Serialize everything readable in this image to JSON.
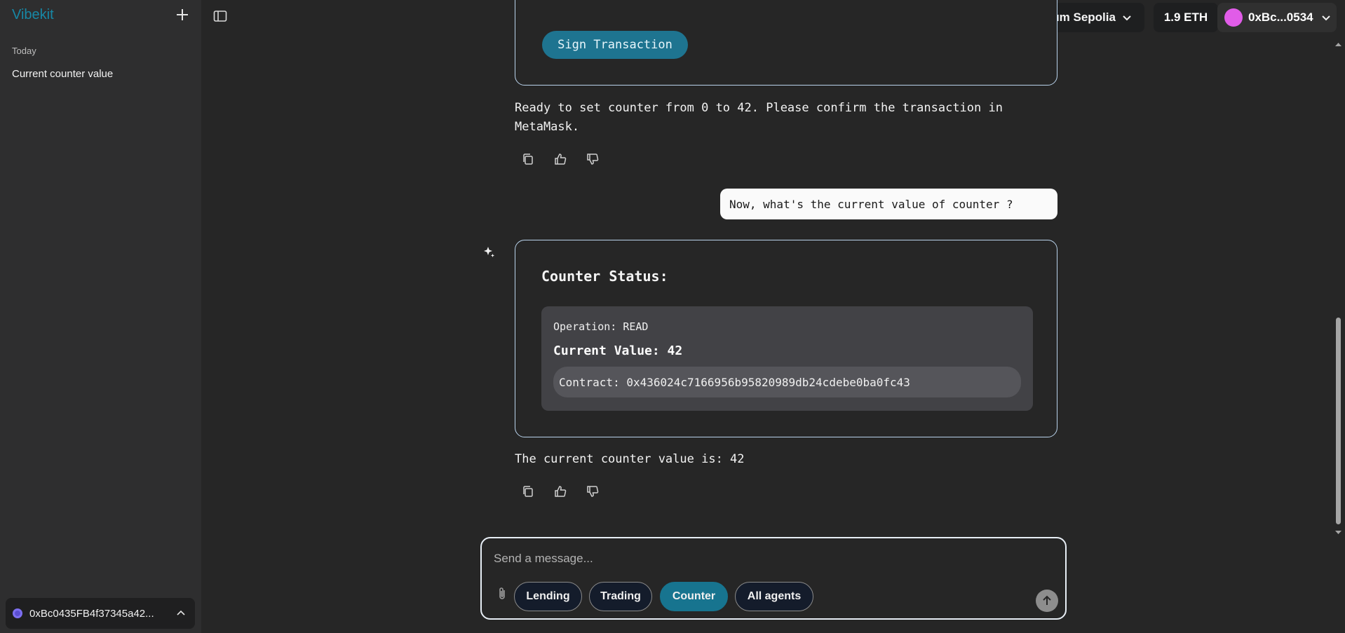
{
  "sidebar": {
    "brand": "Vibekit",
    "section_label": "Today",
    "history": [
      "Current counter value"
    ],
    "wallet_address": "0xBc0435FB4f37345a42..."
  },
  "topbar": {
    "network": "Arbitrum Sepolia",
    "balance": "1.9 ETH",
    "account": "0xBc...0534"
  },
  "chat": {
    "sign_button": "Sign Transaction",
    "ready_text_line1": "Ready to set counter from 0 to 42. Please confirm the transaction in",
    "ready_text_line2": "MetaMask.",
    "user_message": "Now, what's the current value of counter ?",
    "status_card": {
      "title": "Counter Status:",
      "operation": "Operation: READ",
      "current_value": "Current Value: 42",
      "contract": "Contract: 0x436024c7166956b95820989db24cdebe0ba0fc43"
    },
    "answer": "The current counter value is: 42"
  },
  "composer": {
    "placeholder": "Send a message...",
    "chips": [
      "Lending",
      "Trading",
      "Counter",
      "All agents"
    ],
    "active_chip": "Counter"
  },
  "colors": {
    "accent": "#1e7490",
    "brand": "#1788a6",
    "background": "#262626",
    "sidebar": "#2e2e2f"
  }
}
